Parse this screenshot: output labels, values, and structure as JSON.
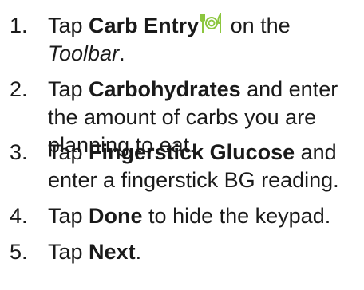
{
  "steps": [
    {
      "number": "1.",
      "text_before": "Tap ",
      "bold": "Carb Entry",
      "icon": "fork-plate-knife-icon",
      "text_after": " on the",
      "line2_italic": "Toolbar",
      "line2_end": "."
    },
    {
      "number": "2.",
      "text_before": "Tap ",
      "bold": "Carbohydrates",
      "text_after": " and enter",
      "line2": "the amount of carbs you are",
      "line3": "planning to eat."
    },
    {
      "number": "3.",
      "text_before": "Tap ",
      "bold": "Fingerstick Glucose",
      "text_after": " and",
      "line2": "enter a fingerstick BG reading."
    },
    {
      "number": "4.",
      "text_before": "Tap ",
      "bold": "Done",
      "text_after": " to hide the keypad."
    },
    {
      "number": "5.",
      "text_before": "Tap ",
      "bold": "Next",
      "text_after": "."
    }
  ],
  "colors": {
    "text": "#1a1a1a",
    "icon": "#8cc63f"
  }
}
